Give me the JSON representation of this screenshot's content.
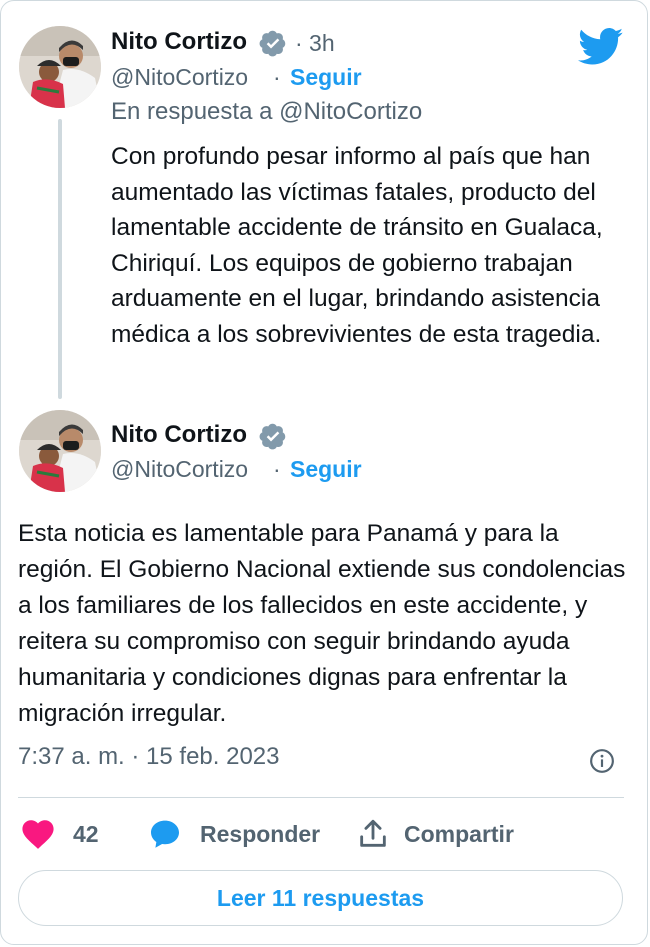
{
  "colors": {
    "accent": "#1d9bf0",
    "text": "#0f1419",
    "muted": "#536471",
    "like": "#f91880",
    "border": "#cfd9de"
  },
  "reply_tweet": {
    "author_name": "Nito Cortizo",
    "handle": "@NitoCortizo",
    "time_ago": "· 3h",
    "follow_label": "Seguir",
    "separator": "·",
    "in_reply_to": "En respuesta a @NitoCortizo",
    "text": "Con profundo pesar informo al país que han aumentado las víctimas fatales, producto del lamentable accidente de tránsito en Gualaca, Chiriquí. Los equipos de gobierno trabajan arduamente en el lugar, brindando asistencia médica a los sobrevivientes de esta tragedia."
  },
  "main_tweet": {
    "author_name": "Nito Cortizo",
    "handle": "@NitoCortizo",
    "separator": "·",
    "follow_label": "Seguir",
    "text": "Esta noticia es lamentable para Panamá y para la región. El Gobierno Nacional extiende sus condolencias a los familiares de los fallecidos en este accidente, y reitera su compromiso con seguir brindando ayuda humanitaria y condiciones dignas para enfrentar la migración irregular.",
    "timestamp": "7:37 a. m. · 15 feb. 2023"
  },
  "actions": {
    "like_count": "42",
    "reply_label": "Responder",
    "share_label": "Compartir"
  },
  "read_replies_label": "Leer 11 respuestas",
  "icons": [
    "twitter-bird-icon",
    "verified-badge-icon",
    "info-icon",
    "heart-icon",
    "reply-bubble-icon",
    "share-icon"
  ]
}
